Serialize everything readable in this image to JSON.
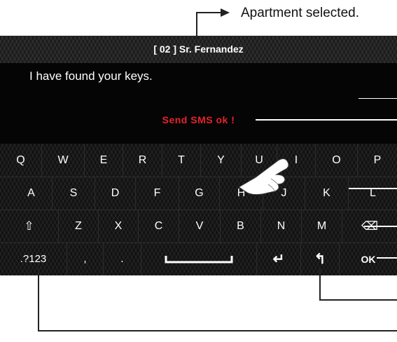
{
  "annotation": {
    "caption": "Apartment selected."
  },
  "header": {
    "title": "[ 02 ]  Sr. Fernandez"
  },
  "message": {
    "text": "I have found your keys."
  },
  "status": {
    "text": "Send  SMS  ok !"
  },
  "keyboard": {
    "row1": [
      "Q",
      "W",
      "E",
      "R",
      "T",
      "Y",
      "U",
      "I",
      "O",
      "P"
    ],
    "row2": [
      "A",
      "S",
      "D",
      "F",
      "G",
      "H",
      "J",
      "K",
      "L"
    ],
    "row3": {
      "shift": "⇧",
      "letters": [
        "Z",
        "X",
        "C",
        "V",
        "B",
        "N",
        "M"
      ],
      "backspace": "⌫"
    },
    "row4": {
      "symbols": ".?123",
      "comma": ",",
      "period": ".",
      "enter": "↵",
      "back": "↰",
      "ok": "OK"
    }
  },
  "colors": {
    "status": "#e8232a",
    "screen": "#050505",
    "text": "#ffffff"
  }
}
